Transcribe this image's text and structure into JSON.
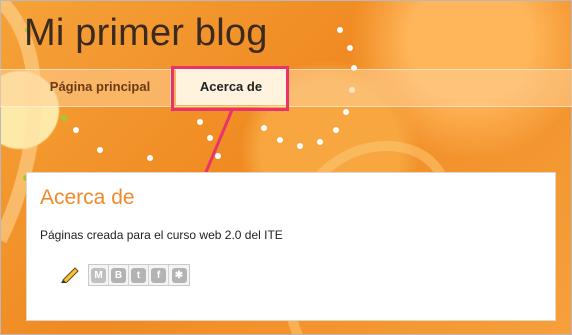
{
  "blog": {
    "title": "Mi primer blog"
  },
  "nav": {
    "tabs": [
      {
        "label": "Página principal",
        "active": false
      },
      {
        "label": "Acerca de",
        "active": true
      }
    ]
  },
  "post": {
    "title": "Acerca de",
    "body": "Páginas creada para el curso web 2.0 del ITE"
  },
  "share": {
    "buttons": [
      {
        "icon": "gmail-icon",
        "glyph": "M"
      },
      {
        "icon": "blogger-icon",
        "glyph": "B"
      },
      {
        "icon": "twitter-icon",
        "glyph": "t"
      },
      {
        "icon": "facebook-icon",
        "glyph": "f"
      },
      {
        "icon": "buzz-icon",
        "glyph": "✱"
      }
    ]
  },
  "colors": {
    "background": "#f39a2e",
    "highlight": "#e8336c",
    "post_title": "#f0892a",
    "blog_title": "#3a2a1f"
  }
}
